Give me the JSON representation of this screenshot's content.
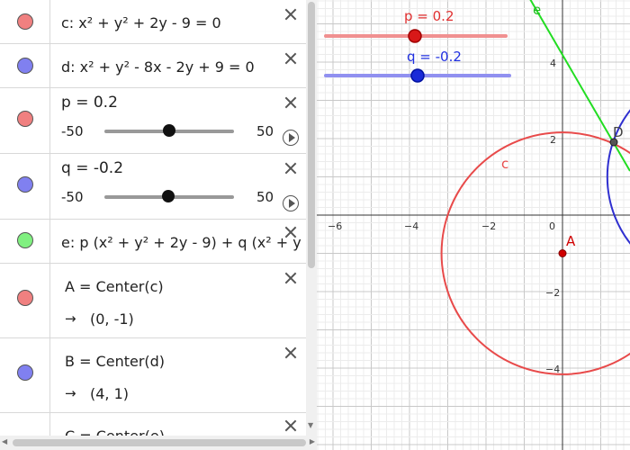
{
  "algebra": {
    "items": [
      {
        "id": "c",
        "color": "#f08080",
        "expr": "c: x² + y² + 2y - 9 = 0"
      },
      {
        "id": "d",
        "color": "#8080f0",
        "expr": "d: x² + y² - 8x - 2y + 9 = 0"
      },
      {
        "id": "p",
        "color": "#f08080",
        "label": "p = 0.2",
        "min": "-50",
        "max": "50",
        "value": 0.2,
        "range": [
          -50,
          50
        ]
      },
      {
        "id": "q",
        "color": "#8080f0",
        "label": "q = -0.2",
        "min": "-50",
        "max": "50",
        "value": -0.2,
        "range": [
          -50,
          50
        ]
      },
      {
        "id": "e",
        "color": "#80f080",
        "expr": "e: p (x² + y² + 2y - 9) + q (x² + y"
      },
      {
        "id": "A",
        "color": "#f08080",
        "def": "A = Center(c)",
        "result": "(0, -1)"
      },
      {
        "id": "B",
        "color": "#8080f0",
        "def": "B = Center(d)",
        "result": "(4, 1)"
      },
      {
        "id": "C",
        "color": "#8080f0",
        "def": "C = Center(e)"
      }
    ],
    "result_arrow": "→"
  },
  "graphics": {
    "slider_p_label": "p = 0.2",
    "slider_q_label": "q = -0.2",
    "slider_p_color": "#e03030",
    "slider_q_color": "#2030e0",
    "label_e": "e",
    "label_c": "c",
    "label_A": "A",
    "label_D": "D",
    "x_ticks": [
      "−6",
      "−4",
      "−2",
      "0"
    ],
    "y_ticks": [
      "4",
      "2",
      "−2",
      "−4"
    ],
    "colors": {
      "circle_c": "#e84a4a",
      "circle_d": "#3030d0",
      "line_e": "#22dd22",
      "point_A": "#d00000",
      "point_D": "#333333"
    }
  }
}
